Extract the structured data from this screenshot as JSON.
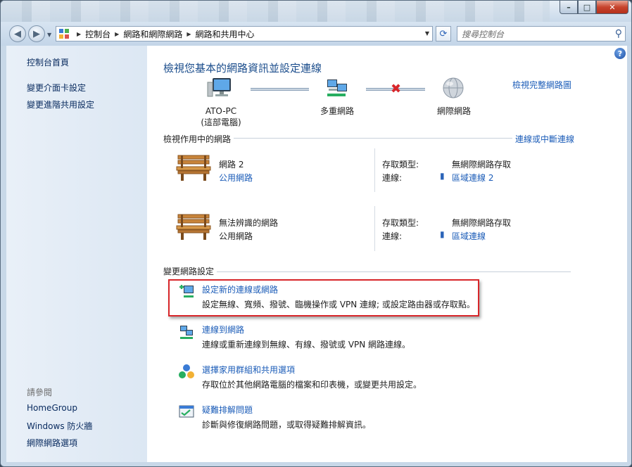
{
  "window": {
    "controls": {
      "minimize": "–",
      "maximize": "□",
      "close": "✕"
    }
  },
  "nav": {
    "back_icon": "back-arrow-icon",
    "forward_icon": "forward-arrow-icon",
    "breadcrumbs": [
      "控制台",
      "網路和網際網路",
      "網路和共用中心"
    ],
    "search_placeholder": "搜尋控制台"
  },
  "sidebar": {
    "home": "控制台首頁",
    "links": [
      "變更介面卡設定",
      "變更進階共用設定"
    ],
    "see_also_heading": "請參閱",
    "see_also": [
      "HomeGroup",
      "Windows 防火牆",
      "網際網路選項"
    ]
  },
  "main": {
    "heading": "檢視您基本的網路資訊並設定連線",
    "full_map_link": "檢視完整網路圖",
    "map": {
      "computer_name": "ATO-PC",
      "computer_sub": "(這部電腦)",
      "network": "多重網路",
      "internet": "網際網路",
      "status_icon": "red-x-icon"
    },
    "active_section": {
      "title": "檢視作用中的網路",
      "action_link": "連線或中斷連線",
      "networks": [
        {
          "name": "網路  2",
          "category": "公用網路",
          "category_is_link": true,
          "access_type_label": "存取類型:",
          "access_type_value": "無網際網路存取",
          "connection_label": "連線:",
          "connection_value": "區域連線 2"
        },
        {
          "name": "無法辨識的網路",
          "category": "公用網路",
          "category_is_link": false,
          "access_type_label": "存取類型:",
          "access_type_value": "無網際網路存取",
          "connection_label": "連線:",
          "connection_value": "區域連線"
        }
      ]
    },
    "change_section": {
      "title": "變更網路設定",
      "tasks": [
        {
          "title": "設定新的連線或網路",
          "desc": "設定無線、寬頻、撥號、臨機操作或 VPN 連線; 或設定路由器或存取點。",
          "icon": "new-connection-icon"
        },
        {
          "title": "連線到網路",
          "desc": "連線或重新連線到無線、有線、撥號或 VPN 網路連線。",
          "icon": "connect-network-icon"
        },
        {
          "title": "選擇家用群組和共用選項",
          "desc": "存取位於其他網路電腦的檔案和印表機，或變更共用設定。",
          "icon": "homegroup-icon"
        },
        {
          "title": "疑難排解問題",
          "desc": "診斷與修復網路問題，或取得疑難排解資訊。",
          "icon": "troubleshoot-icon"
        }
      ]
    }
  },
  "colors": {
    "link": "#1b5cb8",
    "heading": "#1b4d8c",
    "highlight_border": "#d8262a",
    "sidebar_bg": "#e4edf7"
  }
}
